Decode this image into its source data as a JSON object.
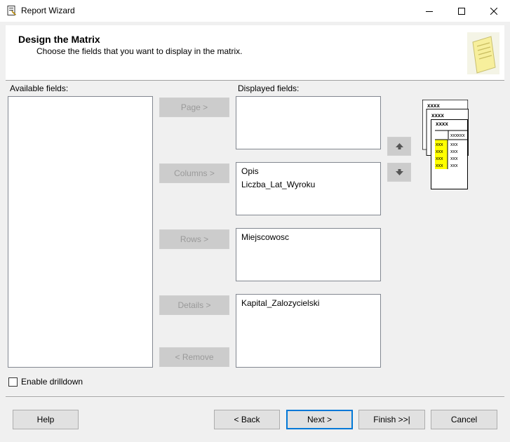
{
  "window": {
    "title": "Report Wizard",
    "icon": "report-wizard-icon"
  },
  "header": {
    "title": "Design the Matrix",
    "subtitle": "Choose the fields that you want to display in the matrix."
  },
  "available": {
    "label": "Available fields:",
    "items": []
  },
  "displayed": {
    "label": "Displayed fields:",
    "page_items": [],
    "column_items": [
      "Opis",
      "Liczba_Lat_Wyroku"
    ],
    "row_items": [
      "Miejscowosc"
    ],
    "detail_items": [
      "Kapital_Zalozycielski"
    ]
  },
  "buttons": {
    "page": "Page >",
    "columns": "Columns >",
    "rows": "Rows >",
    "details": "Details >",
    "remove": "< Remove",
    "help": "Help",
    "back": "< Back",
    "next": "Next >",
    "finish": "Finish >>|",
    "cancel": "Cancel"
  },
  "drilldown": {
    "label": "Enable drilldown",
    "checked": false
  },
  "preview": {
    "page_label": "xxxx",
    "cell": "xxx"
  }
}
